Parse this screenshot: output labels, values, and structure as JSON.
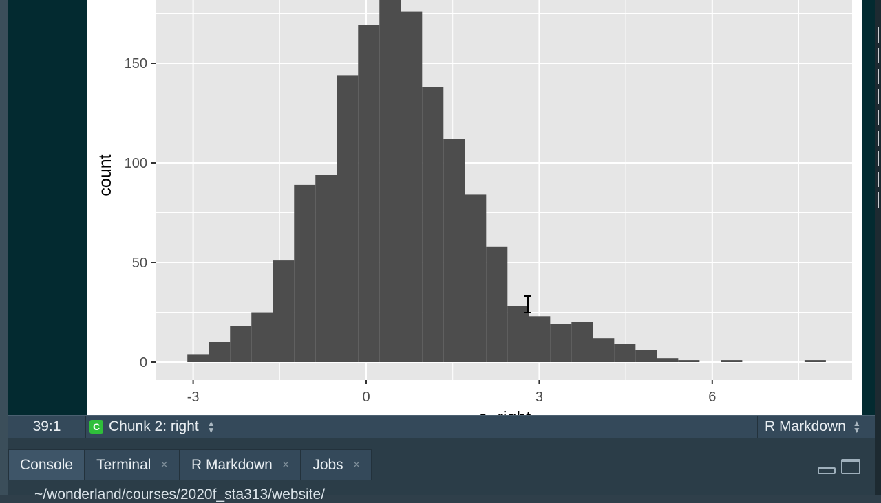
{
  "editor": {
    "cursor_position": "39:1",
    "chunk_icon": "C",
    "chunk_label": "Chunk 2: right",
    "file_type": "R Markdown",
    "updown_icon": "updown-arrows-icon"
  },
  "tabs": [
    {
      "label": "Console",
      "closable": false,
      "active": true
    },
    {
      "label": "Terminal",
      "closable": true,
      "active": false
    },
    {
      "label": "R Markdown",
      "closable": true,
      "active": false
    },
    {
      "label": "Jobs",
      "closable": true,
      "active": false
    }
  ],
  "tab_close_glyph": "×",
  "console": {
    "path": "~/wonderland/courses/2020f_sta313/website/"
  },
  "colors": {
    "panel_background": "#e6e6e6",
    "bar_fill": "#4d4d4d",
    "grid": "#ffffff",
    "chunk_badge": "#2fbf3a"
  },
  "chart_data": {
    "type": "bar",
    "xlabel": "e_right",
    "ylabel": "count",
    "x_ticks": [
      -3,
      0,
      3,
      6
    ],
    "y_ticks": [
      0,
      50,
      100,
      150
    ],
    "bin_width": 0.37,
    "bins": [
      {
        "x0": -3.1,
        "count": 4
      },
      {
        "x0": -2.73,
        "count": 10
      },
      {
        "x0": -2.36,
        "count": 18
      },
      {
        "x0": -1.99,
        "count": 25
      },
      {
        "x0": -1.62,
        "count": 51
      },
      {
        "x0": -1.25,
        "count": 89
      },
      {
        "x0": -0.88,
        "count": 94
      },
      {
        "x0": -0.51,
        "count": 144
      },
      {
        "x0": -0.14,
        "count": 169
      },
      {
        "x0": 0.23,
        "count": 182
      },
      {
        "x0": 0.6,
        "count": 176
      },
      {
        "x0": 0.97,
        "count": 138
      },
      {
        "x0": 1.34,
        "count": 112
      },
      {
        "x0": 1.71,
        "count": 84
      },
      {
        "x0": 2.08,
        "count": 58
      },
      {
        "x0": 2.45,
        "count": 28
      },
      {
        "x0": 2.82,
        "count": 23
      },
      {
        "x0": 3.19,
        "count": 19
      },
      {
        "x0": 3.56,
        "count": 20
      },
      {
        "x0": 3.93,
        "count": 12
      },
      {
        "x0": 4.3,
        "count": 9
      },
      {
        "x0": 4.67,
        "count": 6
      },
      {
        "x0": 5.04,
        "count": 2
      },
      {
        "x0": 5.41,
        "count": 1
      },
      {
        "x0": 6.15,
        "count": 1
      },
      {
        "x0": 7.6,
        "count": 1
      }
    ]
  }
}
